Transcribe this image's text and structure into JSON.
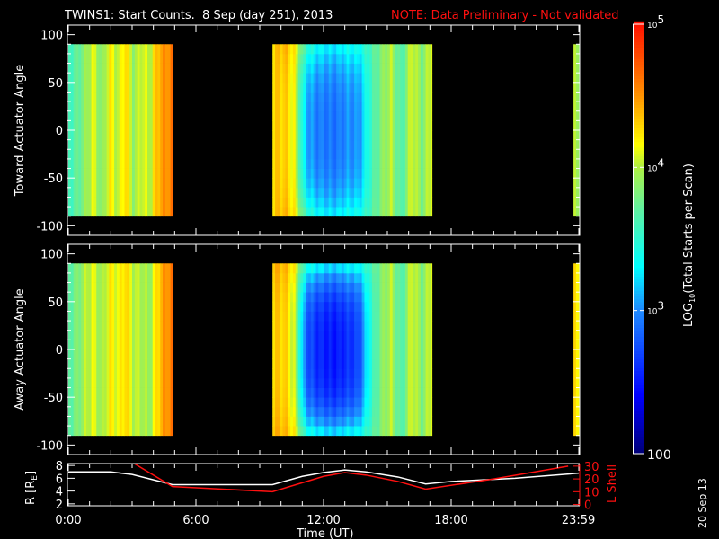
{
  "chart_data": {
    "type": "heatmap",
    "title": "TWINS1: Start Counts.  8 Sep (day 251), 2013",
    "note": "NOTE: Data Preliminary - Not validated",
    "colorbar": {
      "label": "LOG10(Total Starts per Scan)",
      "label_main": "LOG",
      "label_sub": "10",
      "label_rest": "(Total Starts per Scan)",
      "log_range": [
        2,
        5
      ],
      "ticks": [
        {
          "log": 5,
          "base": "10",
          "exp": "5"
        },
        {
          "log": 4,
          "base": "10",
          "exp": "4"
        },
        {
          "log": 3,
          "base": "10",
          "exp": "3"
        },
        {
          "log": 2,
          "base": "100",
          "exp": ""
        }
      ],
      "stops": [
        [
          2,
          "#00007a"
        ],
        [
          2.4,
          "#0000ff"
        ],
        [
          3,
          "#1e8cff"
        ],
        [
          3.3,
          "#00ffff"
        ],
        [
          3.7,
          "#60f0a0"
        ],
        [
          4,
          "#b0f040"
        ],
        [
          4.15,
          "#ffff00"
        ],
        [
          4.5,
          "#ff9000"
        ],
        [
          5,
          "#ff1000"
        ]
      ]
    },
    "xlabel": "Time (UT)",
    "xlim": [
      0,
      24
    ],
    "xticks": [
      {
        "v": 0,
        "l": "0:00"
      },
      {
        "v": 6,
        "l": "6:00"
      },
      {
        "v": 12,
        "l": "12:00"
      },
      {
        "v": 18,
        "l": "18:00"
      },
      {
        "v": 23.983,
        "l": "23:59"
      }
    ],
    "panels": [
      {
        "ylabel": "Toward Actuator Angle",
        "ylim": [
          -110,
          110
        ],
        "yticks": [
          "100",
          "50",
          "0",
          "-50",
          "-100"
        ],
        "ytick_values": [
          100,
          50,
          0,
          -50,
          -100
        ],
        "blocks": [
          {
            "start": 0,
            "end": 4.9,
            "edge": [
              3.6,
              3.7,
              3.9,
              4.1,
              3.8,
              4.2,
              4.0,
              4.3,
              3.9,
              4.1,
              4.0,
              4.4,
              4.5,
              4.6
            ],
            "center": [
              3.6,
              3.7,
              3.9,
              4.1,
              3.8,
              4.2,
              4.0,
              4.3,
              3.9,
              4.1,
              4.0,
              4.4,
              4.5,
              4.6
            ]
          },
          {
            "start": 9.6,
            "end": 17.1,
            "edge": [
              4.3,
              4.4,
              4.2,
              3.6,
              3.4,
              3.3,
              3.3,
              3.4,
              3.4,
              3.6,
              3.8,
              4.0,
              3.6,
              4.1,
              3.8,
              4.2
            ],
            "center": [
              4.3,
              4.3,
              4.1,
              3.1,
              2.95,
              2.9,
              2.9,
              3.0,
              3.0,
              3.5,
              3.8,
              4.0,
              3.6,
              4.1,
              3.8,
              4.2
            ]
          },
          {
            "start": 23.75,
            "end": 24,
            "edge": [
              3.95
            ],
            "center": [
              3.95
            ]
          }
        ]
      },
      {
        "ylabel": "Away Actuator Angle",
        "ylim": [
          -110,
          110
        ],
        "yticks": [
          "100",
          "50",
          "0",
          "-50",
          "-100"
        ],
        "ytick_values": [
          100,
          50,
          0,
          -50,
          -100
        ],
        "blocks": [
          {
            "start": 0,
            "end": 4.9,
            "edge": [
              3.7,
              3.8,
              4.0,
              4.1,
              3.9,
              4.2,
              4.1,
              4.3,
              4.0,
              4.0,
              3.9,
              4.3,
              4.5,
              4.6
            ],
            "center": [
              3.7,
              3.8,
              4.0,
              4.1,
              3.9,
              4.2,
              4.1,
              4.3,
              4.0,
              4.0,
              3.9,
              4.3,
              4.5,
              4.6
            ]
          },
          {
            "start": 9.6,
            "end": 17.1,
            "edge": [
              4.4,
              4.4,
              4.2,
              3.5,
              3.4,
              3.3,
              3.3,
              3.4,
              3.4,
              3.6,
              3.8,
              4.0,
              3.6,
              4.1,
              3.8,
              4.2
            ],
            "center": [
              4.3,
              4.3,
              4.0,
              2.8,
              2.6,
              2.5,
              2.5,
              2.6,
              2.7,
              3.4,
              3.8,
              4.0,
              3.6,
              4.1,
              3.8,
              4.2
            ]
          },
          {
            "start": 23.75,
            "end": 24,
            "edge": [
              4.2
            ],
            "center": [
              4.2
            ]
          }
        ]
      }
    ],
    "orbit": {
      "ylabel_left": "R [R",
      "ylabel_left_sub": "E",
      "ylabel_left_end": "]",
      "ylim_left": [
        1.7,
        8.3
      ],
      "yticks_left": [
        "8",
        "6",
        "4",
        "2"
      ],
      "ytick_left_values": [
        8,
        6,
        4,
        2
      ],
      "ylabel_right": "L Shell",
      "ylim_right": [
        -1,
        32
      ],
      "yticks_right": [
        "30",
        "20",
        "10",
        "0"
      ],
      "ytick_right_values": [
        30,
        20,
        10,
        0
      ],
      "series": [
        {
          "name": "R",
          "color": "#ffffff",
          "x": [
            0,
            2,
            3,
            4.9,
            9.6,
            11,
            12,
            13,
            14,
            15.5,
            16.8,
            18,
            21,
            24
          ],
          "y": [
            7.0,
            7.0,
            6.6,
            5.0,
            5.0,
            6.3,
            6.9,
            7.3,
            7.0,
            6.2,
            5.1,
            5.5,
            6.0,
            6.8
          ]
        },
        {
          "name": "L Shell",
          "color": "#ff1010",
          "x": [
            3.1,
            4.9,
            9.6,
            11,
            12,
            13,
            14,
            15.5,
            16.8,
            20,
            23.5
          ],
          "y": [
            32,
            14,
            10,
            17,
            22,
            25,
            23,
            18,
            12,
            20,
            30
          ]
        }
      ]
    }
  },
  "timestamp": "20 Sep 13"
}
